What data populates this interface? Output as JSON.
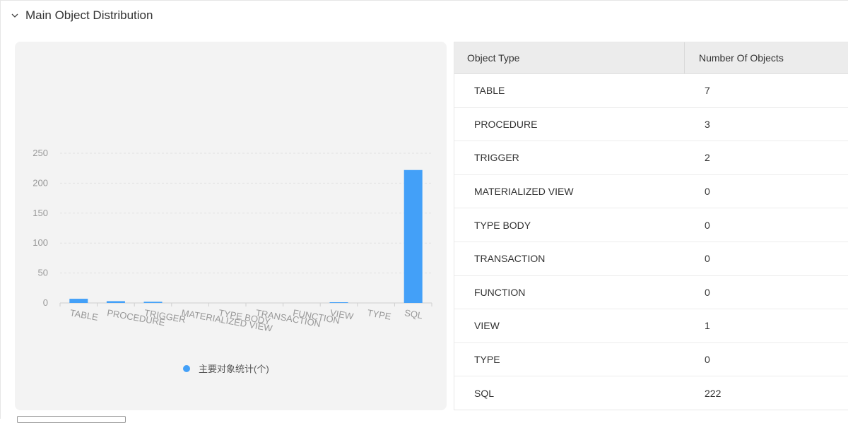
{
  "section": {
    "title": "Main Object Distribution",
    "icon": "chevron-down-icon"
  },
  "table": {
    "headers": [
      "Object Type",
      "Number Of Objects"
    ],
    "rows": [
      [
        "TABLE",
        "7"
      ],
      [
        "PROCEDURE",
        "3"
      ],
      [
        "TRIGGER",
        "2"
      ],
      [
        "MATERIALIZED VIEW",
        "0"
      ],
      [
        "TYPE BODY",
        "0"
      ],
      [
        "TRANSACTION",
        "0"
      ],
      [
        "FUNCTION",
        "0"
      ],
      [
        "VIEW",
        "1"
      ],
      [
        "TYPE",
        "0"
      ],
      [
        "SQL",
        "222"
      ]
    ]
  },
  "chart_data": {
    "type": "bar",
    "categories": [
      "TABLE",
      "PROCEDURE",
      "TRIGGER",
      "MATERIALIZED VIEW",
      "TYPE BODY",
      "TRANSACTION",
      "FUNCTION",
      "VIEW",
      "TYPE",
      "SQL"
    ],
    "series": [
      {
        "name": "主要对象统计(个)",
        "values": [
          7,
          3,
          2,
          0,
          0,
          0,
          0,
          1,
          0,
          222
        ]
      }
    ],
    "yticks": [
      "0",
      "50",
      "100",
      "150",
      "200",
      "250"
    ],
    "ylim": [
      0,
      250
    ],
    "grid": true,
    "legend": "bottom",
    "colors": {
      "bar": "#43a0f8"
    }
  }
}
